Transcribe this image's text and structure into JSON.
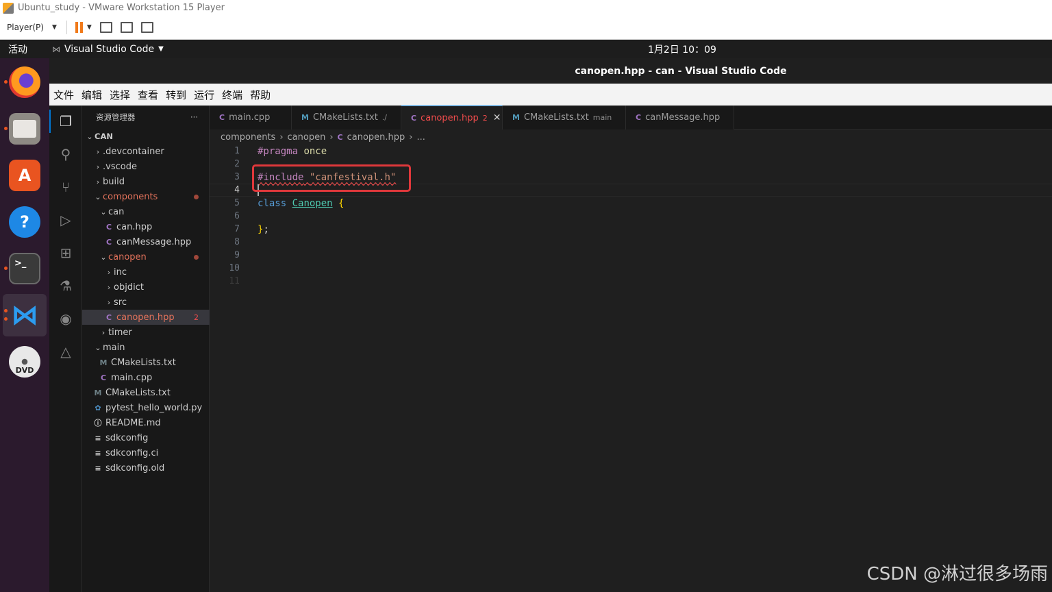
{
  "vm": {
    "title": "Ubuntu_study - VMware Workstation 15 Player",
    "player_menu": "Player(P)"
  },
  "ubuntu": {
    "activities": "活动",
    "app_menu": "Visual Studio Code",
    "clock": "1月2日  10：09"
  },
  "dock": {
    "apps": [
      "firefox-icon",
      "files-icon",
      "software-center-icon",
      "help-icon",
      "terminal-icon",
      "vscode-icon",
      "dvd-icon"
    ]
  },
  "vscode": {
    "title": "canopen.hpp - can - Visual Studio Code",
    "menu": [
      "文件",
      "编辑",
      "选择",
      "查看",
      "转到",
      "运行",
      "终端",
      "帮助"
    ],
    "explorer_title": "资源管理器",
    "explorer_more": "···",
    "tree": [
      {
        "label": "CAN",
        "type": "root"
      },
      {
        "label": ".devcontainer",
        "type": "folder"
      },
      {
        "label": ".vscode",
        "type": "folder"
      },
      {
        "label": "build",
        "type": "folder"
      },
      {
        "label": "components",
        "type": "folder-open",
        "modified": true
      },
      {
        "label": "can",
        "type": "folder-open"
      },
      {
        "label": "can.hpp",
        "type": "cpp"
      },
      {
        "label": "canMessage.hpp",
        "type": "cpp"
      },
      {
        "label": "canopen",
        "type": "folder-open",
        "modified": true
      },
      {
        "label": "inc",
        "type": "folder"
      },
      {
        "label": "objdict",
        "type": "folder"
      },
      {
        "label": "src",
        "type": "folder"
      },
      {
        "label": "canopen.hpp",
        "type": "cpp",
        "badge": "2"
      },
      {
        "label": "timer",
        "type": "folder"
      },
      {
        "label": "main",
        "type": "folder-open"
      },
      {
        "label": "CMakeLists.txt",
        "type": "cmake"
      },
      {
        "label": "main.cpp",
        "type": "cpp"
      },
      {
        "label": "CMakeLists.txt",
        "type": "cmake"
      },
      {
        "label": "pytest_hello_world.py",
        "type": "py"
      },
      {
        "label": "README.md",
        "type": "info"
      },
      {
        "label": "sdkconfig",
        "type": "txt"
      },
      {
        "label": "sdkconfig.ci",
        "type": "txt"
      },
      {
        "label": "sdkconfig.old",
        "type": "txt"
      }
    ],
    "tabs": [
      {
        "label": "main.cpp",
        "desc": ""
      },
      {
        "label": "CMakeLists.txt",
        "desc": "./"
      },
      {
        "label": "canopen.hpp",
        "desc": "2",
        "active": true
      },
      {
        "label": "CMakeLists.txt",
        "desc": "main"
      },
      {
        "label": "canMessage.hpp",
        "desc": ""
      }
    ],
    "breadcrumb": [
      "components",
      "canopen",
      "canopen.hpp",
      "..."
    ],
    "breadcrumb_sep": "›",
    "line_numbers": [
      "1",
      "2",
      "3",
      "4",
      "5",
      "6",
      "7",
      "8",
      "9",
      "10",
      "11"
    ],
    "code": {
      "l1_pp": "#pragma",
      "l1_rest": " once",
      "l3_pp": "#include",
      "l3_str": "\"canfestival.h\"",
      "l5_kw": "class",
      "l5_type": "Canopen",
      "l5_brace": "{",
      "l7_brace": "}",
      "l7_semi": ";"
    }
  },
  "watermark": "CSDN @淋过很多场雨"
}
